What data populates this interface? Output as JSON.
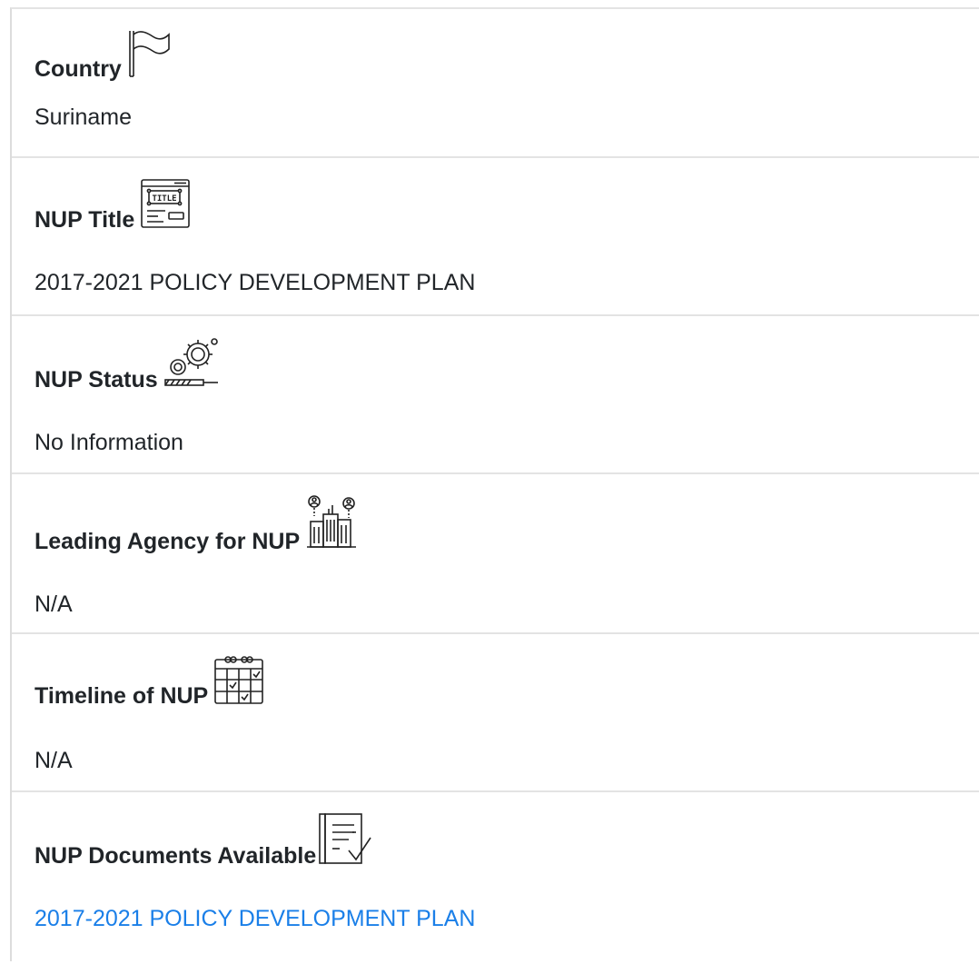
{
  "fields": {
    "country": {
      "label": "Country",
      "icon": "flag-icon",
      "value": "Suriname"
    },
    "nup_title": {
      "label": "NUP Title",
      "icon": "title-window-icon",
      "value": "2017-2021 POLICY DEVELOPMENT PLAN"
    },
    "nup_status": {
      "label": "NUP Status",
      "icon": "gears-progress-icon",
      "value": "No Information"
    },
    "leading_agency": {
      "label": "Leading Agency for NUP",
      "icon": "buildings-people-icon",
      "value": "N/A"
    },
    "timeline": {
      "label": "Timeline of NUP",
      "icon": "calendar-icon",
      "value": "N/A"
    },
    "documents": {
      "label": "NUP Documents Available",
      "icon": "document-check-icon",
      "value": "2017-2021 POLICY DEVELOPMENT PLAN"
    }
  },
  "colors": {
    "text": "#212529",
    "link": "#1a7fe8",
    "divider": "#e3e3e3"
  }
}
